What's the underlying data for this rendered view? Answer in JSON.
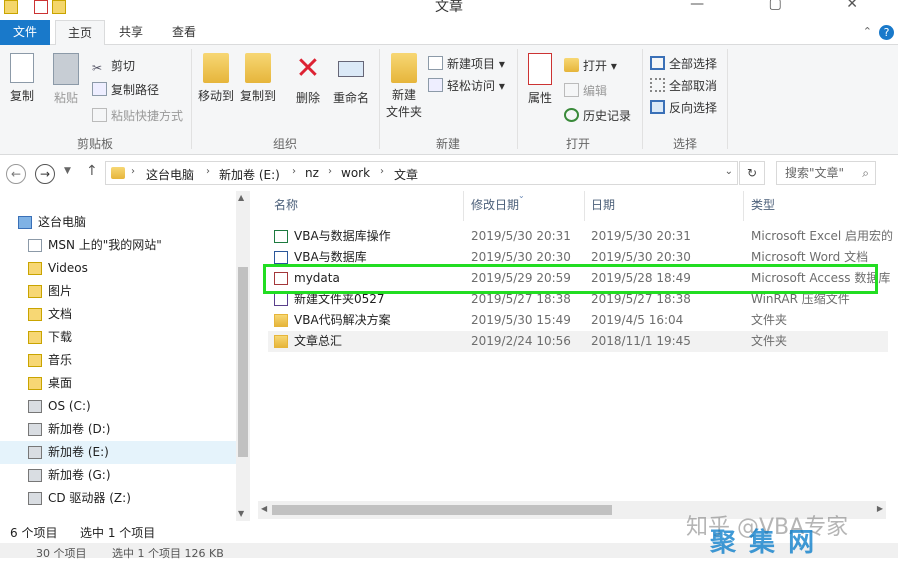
{
  "window": {
    "title": "文章",
    "controls": "— ▢ ✕"
  },
  "ribbon_tabs": [
    "文件",
    "主页",
    "共享",
    "查看"
  ],
  "ribbon": {
    "clipboard": {
      "copy": "复制",
      "paste": "粘贴",
      "cut": "剪切",
      "copy_path": "复制路径",
      "paste_shortcut": "粘贴快捷方式",
      "label": "剪贴板"
    },
    "organize": {
      "move_to": "移动到",
      "copy_to": "复制到",
      "delete": "删除",
      "rename": "重命名",
      "label": "组织"
    },
    "new": {
      "new_folder": "新建\n文件夹",
      "new_item": "新建项目",
      "easy_access": "轻松访问",
      "label": "新建"
    },
    "open": {
      "properties": "属性",
      "open": "打开",
      "edit": "编辑",
      "history": "历史记录",
      "label": "打开"
    },
    "select": {
      "select_all": "全部选择",
      "select_none": "全部取消",
      "invert": "反向选择",
      "label": "选择"
    }
  },
  "address": {
    "crumbs": [
      "这台电脑",
      "新加卷 (E:)",
      "nz",
      "work",
      "文章"
    ],
    "search_placeholder": "搜索\"文章\""
  },
  "nav": [
    {
      "label": "这台电脑",
      "icon": "computer-icon"
    },
    {
      "label": "MSN 上的\"我的网站\"",
      "icon": "document-icon"
    },
    {
      "label": "Videos",
      "icon": "folder-icon"
    },
    {
      "label": "图片",
      "icon": "folder-icon"
    },
    {
      "label": "文档",
      "icon": "folder-icon"
    },
    {
      "label": "下载",
      "icon": "folder-icon"
    },
    {
      "label": "音乐",
      "icon": "folder-icon"
    },
    {
      "label": "桌面",
      "icon": "folder-icon"
    },
    {
      "label": "OS (C:)",
      "icon": "windows-drive-icon"
    },
    {
      "label": "新加卷 (D:)",
      "icon": "drive-icon"
    },
    {
      "label": "新加卷 (E:)",
      "icon": "drive-icon",
      "selected": true
    },
    {
      "label": "新加卷 (G:)",
      "icon": "drive-icon"
    },
    {
      "label": "CD 驱动器 (Z:)",
      "icon": "cd-drive-icon"
    }
  ],
  "columns": {
    "name": "名称",
    "modified": "修改日期",
    "date": "日期",
    "type": "类型"
  },
  "files": [
    {
      "name": "VBA与数据库操作",
      "modified": "2019/5/30 20:31",
      "date": "2019/5/30 20:31",
      "type": "Microsoft Excel 启用宏的",
      "icon": "excel-icon",
      "color": "#1d7a3f"
    },
    {
      "name": "VBA与数据库",
      "modified": "2019/5/30 20:30",
      "date": "2019/5/30 20:30",
      "type": "Microsoft Word 文档",
      "icon": "word-icon",
      "color": "#2b579a"
    },
    {
      "name": "mydata",
      "modified": "2019/5/29 20:59",
      "date": "2019/5/28 18:49",
      "type": "Microsoft Access 数据库",
      "icon": "access-icon",
      "color": "#a4373a"
    },
    {
      "name": "新建文件夹0527",
      "modified": "2019/5/27 18:38",
      "date": "2019/5/27 18:38",
      "type": "WinRAR 压缩文件",
      "icon": "winrar-icon",
      "color": "#5a3f8c"
    },
    {
      "name": "VBA代码解决方案",
      "modified": "2019/5/30 15:49",
      "date": "2019/4/5 16:04",
      "type": "文件夹",
      "icon": "folder-icon",
      "color": "#e6b53b"
    },
    {
      "name": "文章总汇",
      "modified": "2019/2/24 10:56",
      "date": "2018/11/1 19:45",
      "type": "文件夹",
      "icon": "folder-icon",
      "color": "#e6b53b",
      "selected": true
    }
  ],
  "status": {
    "count": "6 个项目",
    "selected": "选中 1 个项目"
  },
  "status_cut": {
    "count": "30 个项目",
    "selected": "选中 1 个项目 126 KB"
  },
  "watermark": {
    "line1": "知乎 @VBA专家",
    "line2": "聚 集 网"
  }
}
